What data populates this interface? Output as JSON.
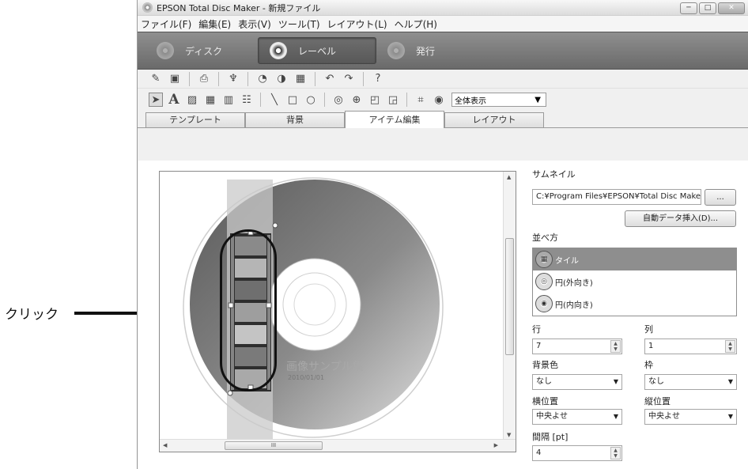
{
  "callout": {
    "label": "クリック"
  },
  "window": {
    "title": "EPSON Total Disc Maker - 新規ファイル",
    "controls": {
      "minimize": "─",
      "maximize": "□",
      "close": "✕"
    }
  },
  "menu": [
    "ファイル(F)",
    "編集(E)",
    "表示(V)",
    "ツール(T)",
    "レイアウト(L)",
    "ヘルプ(H)"
  ],
  "modes": [
    {
      "label": "ディスク",
      "active": false
    },
    {
      "label": "レーベル",
      "active": true
    },
    {
      "label": "発行",
      "active": false
    }
  ],
  "toolbar2": {
    "zoom": "全体表示"
  },
  "tabs": [
    {
      "label": "テンプレート",
      "active": false
    },
    {
      "label": "背景",
      "active": false
    },
    {
      "label": "アイテム編集",
      "active": true
    },
    {
      "label": "レイアウト",
      "active": false
    }
  ],
  "canvas": {
    "disc_title": "画像サンプル集",
    "disc_date": "2010/01/01",
    "scroll_grip": "III"
  },
  "panel": {
    "thumbnail_label": "サムネイル",
    "thumbnail_path": "C:¥Program Files¥EPSON¥Total Disc Maker¥Ten",
    "browse_button": "...",
    "auto_insert_button": "自動データ挿入(D)...",
    "arrange_label": "並べ方",
    "arrange_options": [
      {
        "label": "タイル",
        "selected": true
      },
      {
        "label": "円(外向き)",
        "selected": false
      },
      {
        "label": "円(内向き)",
        "selected": false
      }
    ],
    "rows_label": "行",
    "rows_value": "7",
    "cols_label": "列",
    "cols_value": "1",
    "bg_color_label": "背景色",
    "bg_color_value": "なし",
    "frame_label": "枠",
    "frame_value": "なし",
    "h_pos_label": "横位置",
    "h_pos_value": "中央よせ",
    "v_pos_label": "縦位置",
    "v_pos_value": "中央よせ",
    "spacing_label": "間隔 [pt]",
    "spacing_value": "4"
  }
}
